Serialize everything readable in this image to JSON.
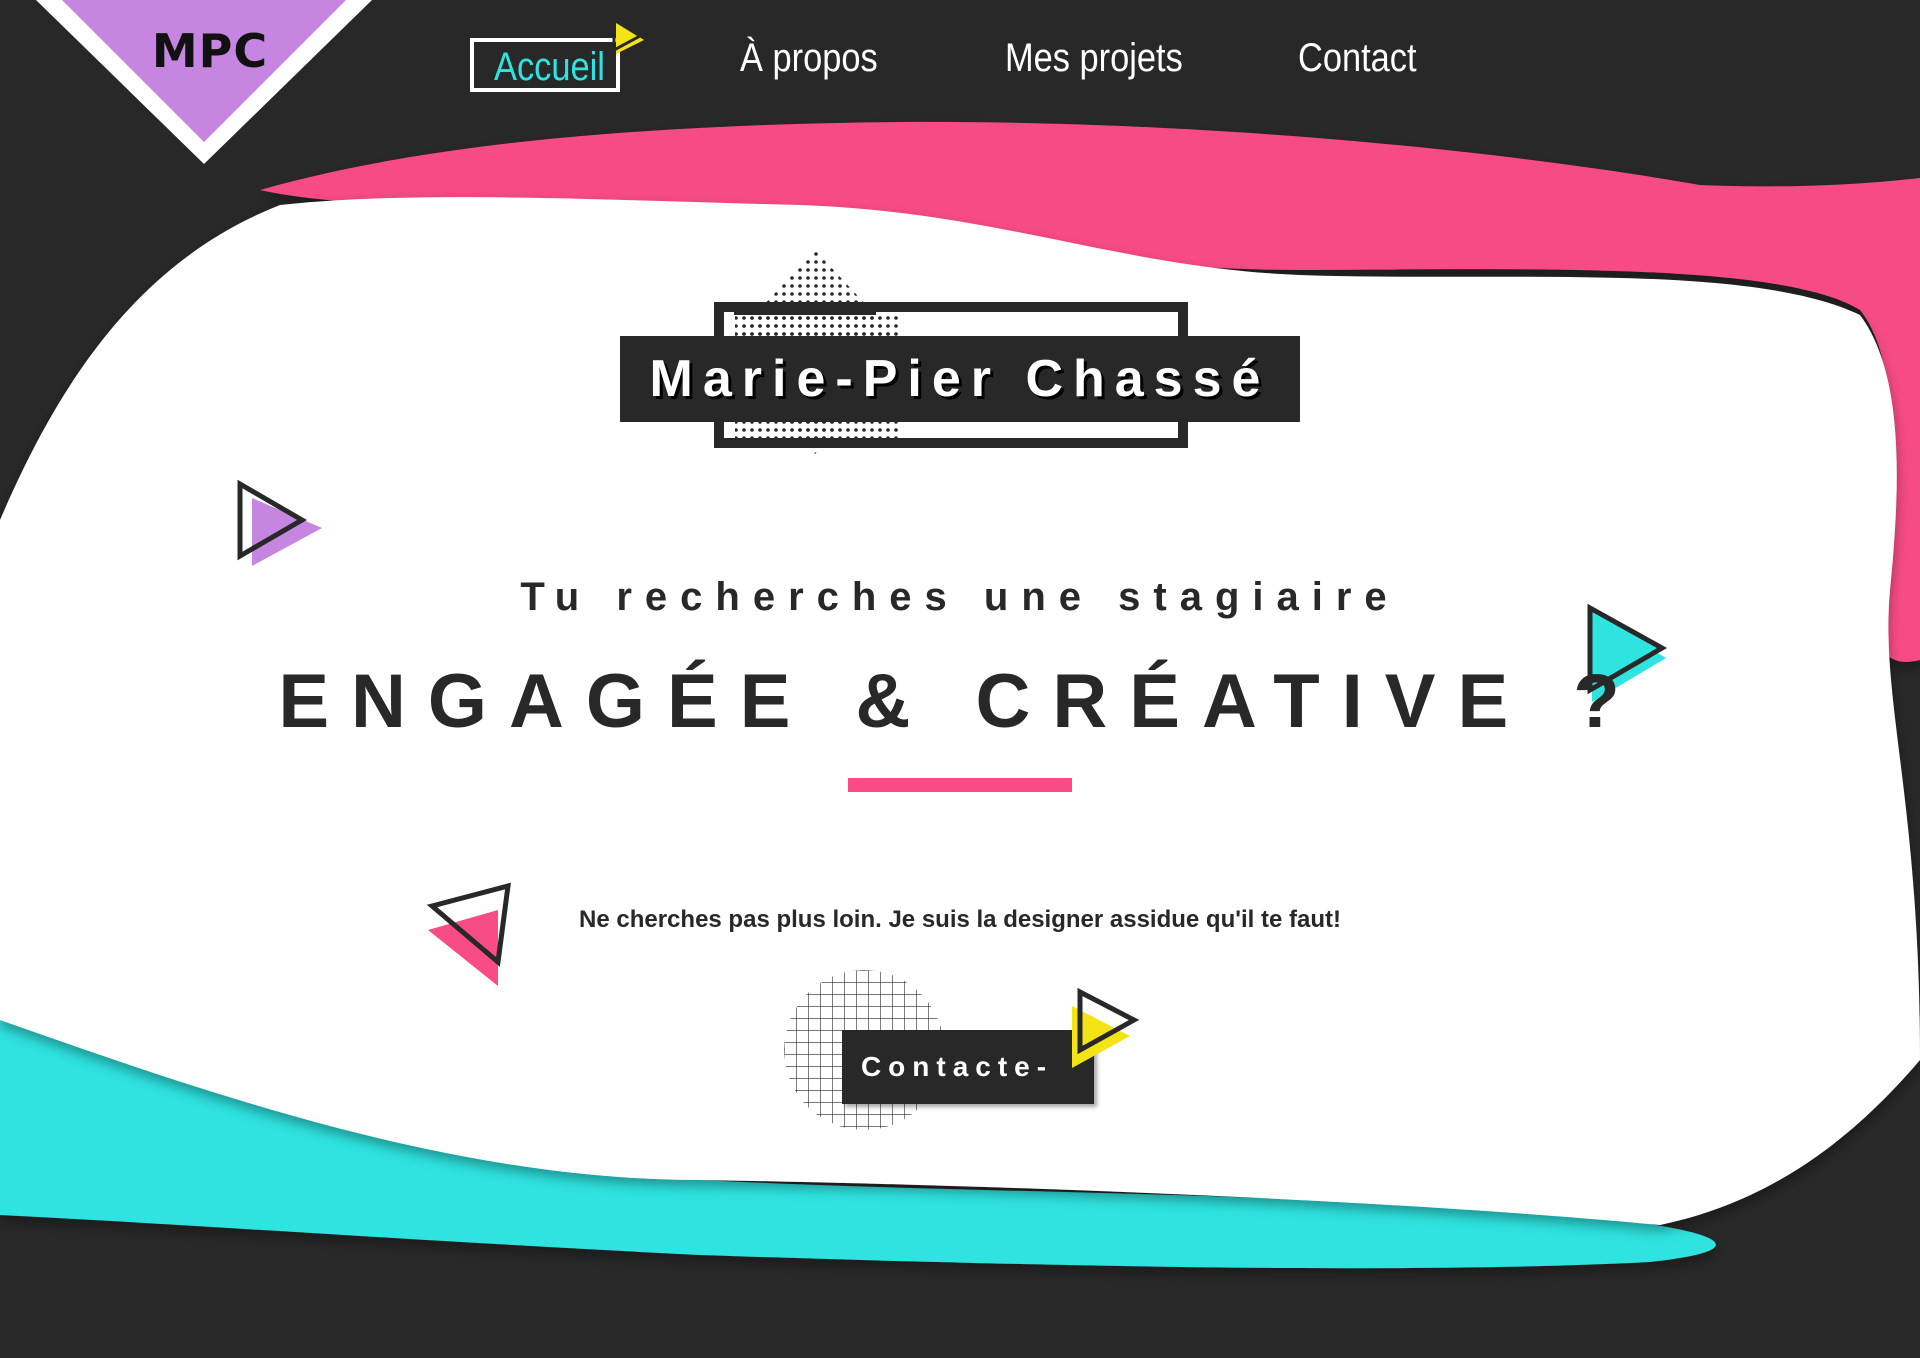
{
  "logo": {
    "text": "MPC"
  },
  "nav": {
    "items": [
      {
        "label": "Accueil",
        "active": true
      },
      {
        "label": "À propos"
      },
      {
        "label": "Mes projets"
      },
      {
        "label": "Contact"
      }
    ]
  },
  "hero": {
    "name": "Marie-Pier Chassé",
    "subtitle": "Tu recherches une stagiaire",
    "title": "ENGAGÉE & CRÉATIVE ?",
    "tagline": "Ne cherches pas plus loin.  Je suis la designer assidue qu'il te faut!"
  },
  "cta": {
    "label": "Contacte-moi"
  },
  "colors": {
    "dark": "#282828",
    "pink": "#f74c85",
    "cyan": "#2ee3e0",
    "purple": "#c585e0",
    "yellow": "#f4e415",
    "white": "#ffffff"
  },
  "icons": [
    "play-triangle-icon",
    "hollow-triangle-icon"
  ]
}
